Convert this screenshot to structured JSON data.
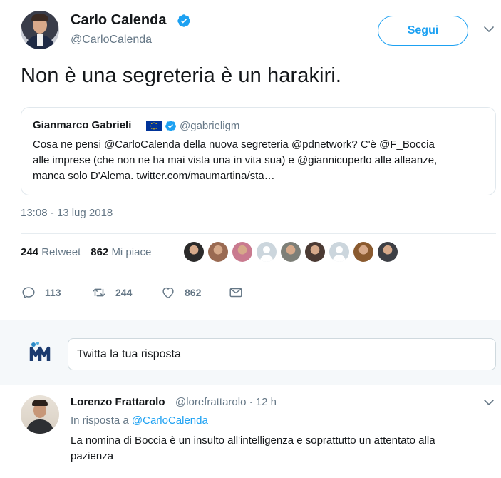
{
  "tweet": {
    "author_name": "Carlo Calenda",
    "author_handle": "@CarloCalenda",
    "follow_label": "Segui",
    "text": "Non è una segreteria è un harakiri.",
    "timestamp": "13:08 - 13 lug 2018",
    "verified_icon": "verified-badge-icon"
  },
  "quoted_tweet": {
    "author_name": "Gianmarco Gabrieli",
    "author_handle": "@gabrieligm",
    "flag_icon": "eu-flag-icon",
    "text_line_1": "Cosa ne pensi @CarloCalenda della nuova segreteria @pdnetwork? C'è @F_Boccia",
    "text_line_2": "alle imprese (che non ne ha mai vista una in vita sua) e @giannicuperlo alle alleanze,",
    "text_line_3": "manca solo D'Alema. twitter.com/maumartina/sta…"
  },
  "stats": {
    "retweet_count": "244",
    "retweet_label": "Retweet",
    "like_count": "862",
    "like_label": "Mi piace",
    "likers": [
      {
        "name": "liker-avatar-1",
        "color": "#2b2a2a"
      },
      {
        "name": "liker-avatar-2",
        "color": "#9a6a52"
      },
      {
        "name": "liker-avatar-3",
        "color": "#c97a8f"
      },
      {
        "name": "liker-avatar-4",
        "color": "#ccd6dd"
      },
      {
        "name": "liker-avatar-5",
        "color": "#7d7f78"
      },
      {
        "name": "liker-avatar-6",
        "color": "#4b3a33"
      },
      {
        "name": "liker-avatar-7",
        "color": "#ccd6dd"
      },
      {
        "name": "liker-avatar-8",
        "color": "#8a5a2f"
      },
      {
        "name": "liker-avatar-9",
        "color": "#3d3f45"
      }
    ]
  },
  "actions": {
    "reply_count": "113",
    "retweet_count": "244",
    "like_count": "862"
  },
  "reply_box": {
    "placeholder": "Twitta la tua risposta"
  },
  "reply": {
    "author_name": "Lorenzo Frattarolo",
    "meta": "@lorefrattarolo · 12 h",
    "in_reply_prefix": "In risposta a",
    "in_reply_handle": "@CarloCalenda",
    "text_line_1": "La nomina di Boccia è un insulto all'intelligenza e soprattutto un attentato alla",
    "text_line_2": "pazienza"
  },
  "colors": {
    "accent": "#1da1f2",
    "muted": "#657786",
    "border": "#e6ecf0"
  }
}
